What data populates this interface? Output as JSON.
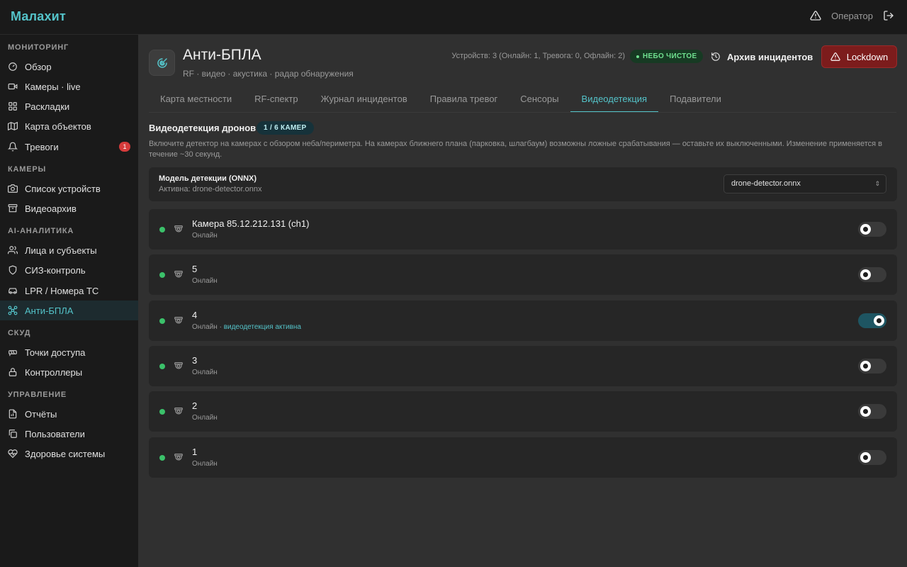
{
  "app": {
    "brand": "Малахит"
  },
  "topbar": {
    "user_label": "Оператор"
  },
  "sidebar": {
    "sections": [
      {
        "title": "Мониторинг",
        "items": [
          {
            "label": "Обзор",
            "icon": "gauge-icon"
          },
          {
            "label": "Камеры · live",
            "icon": "video-icon"
          },
          {
            "label": "Раскладки",
            "icon": "grid-icon"
          },
          {
            "label": "Карта объектов",
            "icon": "map-icon"
          },
          {
            "label": "Тревоги",
            "icon": "bell-icon",
            "badge": "1"
          }
        ]
      },
      {
        "title": "Камеры",
        "items": [
          {
            "label": "Список устройств",
            "icon": "camera-icon"
          },
          {
            "label": "Видеоархив",
            "icon": "archive-icon"
          }
        ]
      },
      {
        "title": "AI-аналитика",
        "items": [
          {
            "label": "Лица и субъекты",
            "icon": "users-icon"
          },
          {
            "label": "СИЗ-контроль",
            "icon": "shield-icon"
          },
          {
            "label": "LPR / Номера ТС",
            "icon": "car-icon"
          },
          {
            "label": "Анти-БПЛА",
            "icon": "drone-icon",
            "active": true
          }
        ]
      },
      {
        "title": "СКУД",
        "items": [
          {
            "label": "Точки доступа",
            "icon": "door-icon"
          },
          {
            "label": "Контроллеры",
            "icon": "lock-icon"
          }
        ]
      },
      {
        "title": "Управление",
        "items": [
          {
            "label": "Отчёты",
            "icon": "report-icon"
          },
          {
            "label": "Пользователи",
            "icon": "user-copy-icon"
          },
          {
            "label": "Здоровье системы",
            "icon": "heart-pulse-icon"
          }
        ]
      }
    ]
  },
  "header": {
    "title": "Анти-БПЛА",
    "subtitle": "RF · видео · акустика · радар обнаружения",
    "device_stats": "Устройств: 3 (Онлайн: 1, Тревога: 0, Офлайн: 2)",
    "sky_badge": "НЕБО ЧИСТОЕ",
    "archive_label": "Архив инцидентов",
    "lockdown_label": "Lockdown"
  },
  "tabs": [
    {
      "label": "Карта местности"
    },
    {
      "label": "RF-спектр"
    },
    {
      "label": "Журнал инцидентов"
    },
    {
      "label": "Правила тревог"
    },
    {
      "label": "Сенсоры"
    },
    {
      "label": "Видеодетекция",
      "active": true
    },
    {
      "label": "Подавители"
    }
  ],
  "detection": {
    "title": "Видеодетекция дронов",
    "count_badge": "1 / 6 КАМЕР",
    "description": "Включите детектор на камерах с обзором неба/периметра. На камерах ближнего плана (парковка, шлагбаум) возможны ложные срабатывания — оставьте их выключенными. Изменение применяется в течение ~30 секунд.",
    "model_label": "Модель детекции (ONNX)",
    "model_active": "Активна: drone-detector.onnx",
    "model_selected": "drone-detector.onnx"
  },
  "cameras": [
    {
      "name": "Камера 85.12.212.131 (ch1)",
      "status": "Онлайн",
      "detection_label": "",
      "enabled": false
    },
    {
      "name": "5",
      "status": "Онлайн",
      "detection_label": "",
      "enabled": false
    },
    {
      "name": "4",
      "status": "Онлайн",
      "detection_label": "видеодетекция активна",
      "enabled": true
    },
    {
      "name": "3",
      "status": "Онлайн",
      "detection_label": "",
      "enabled": false
    },
    {
      "name": "2",
      "status": "Онлайн",
      "detection_label": "",
      "enabled": false
    },
    {
      "name": "1",
      "status": "Онлайн",
      "detection_label": "",
      "enabled": false
    }
  ],
  "colors": {
    "accent": "#54c3c9",
    "danger": "#7c1c1c",
    "online": "#3bc16a"
  }
}
